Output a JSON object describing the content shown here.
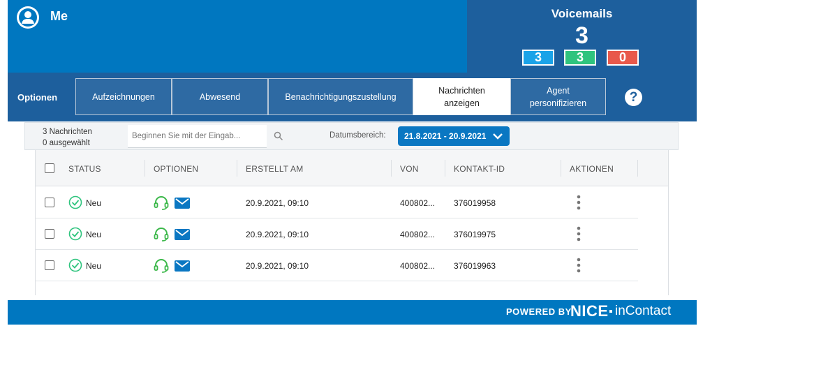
{
  "header": {
    "user_name": "Me",
    "avatar_icon": "user-avatar-icon"
  },
  "voicemails": {
    "title": "Voicemails",
    "total": "3",
    "badges": [
      {
        "value": "3",
        "color": "#1aa3e8"
      },
      {
        "value": "3",
        "color": "#2fc47e"
      },
      {
        "value": "0",
        "color": "#e8594b"
      }
    ]
  },
  "nav": {
    "label": "Optionen",
    "tabs": [
      {
        "label": "Aufzeichnungen",
        "active": false
      },
      {
        "label": "Abwesend",
        "active": false
      },
      {
        "label": "Benachrichtigungszustellung",
        "active": false
      },
      {
        "label": "Nachrichten anzeigen",
        "active": true
      },
      {
        "label": "Agent personifizieren",
        "active": false
      }
    ],
    "help": "?"
  },
  "filter": {
    "message_count": "3 Nachrichten",
    "selected_count": "0 ausgewählt",
    "search_placeholder": "Beginnen Sie mit der Eingab...",
    "date_label": "Datumsbereich:",
    "date_range": "21.8.2021 - 20.9.2021"
  },
  "table": {
    "columns": [
      "STATUS",
      "OPTIONEN",
      "ERSTELLT AM",
      "VON",
      "KONTAKT-ID",
      "AKTIONEN"
    ],
    "rows": [
      {
        "status": "Neu",
        "created": "20.9.2021, 09:10",
        "from": "400802...",
        "contact_id": "376019958"
      },
      {
        "status": "Neu",
        "created": "20.9.2021, 09:10",
        "from": "400802...",
        "contact_id": "376019975"
      },
      {
        "status": "Neu",
        "created": "20.9.2021, 09:10",
        "from": "400802...",
        "contact_id": "376019963"
      }
    ]
  },
  "footer": {
    "powered_by": "POWERED BY",
    "brand_nice": "NICE",
    "brand_incontact": "inContact"
  },
  "colors": {
    "header_blue": "#0077c0",
    "nav_blue": "#1d5f9d",
    "status_green": "#2fc47e",
    "headset_green": "#3cb84a",
    "mail_blue": "#0a77c2"
  }
}
